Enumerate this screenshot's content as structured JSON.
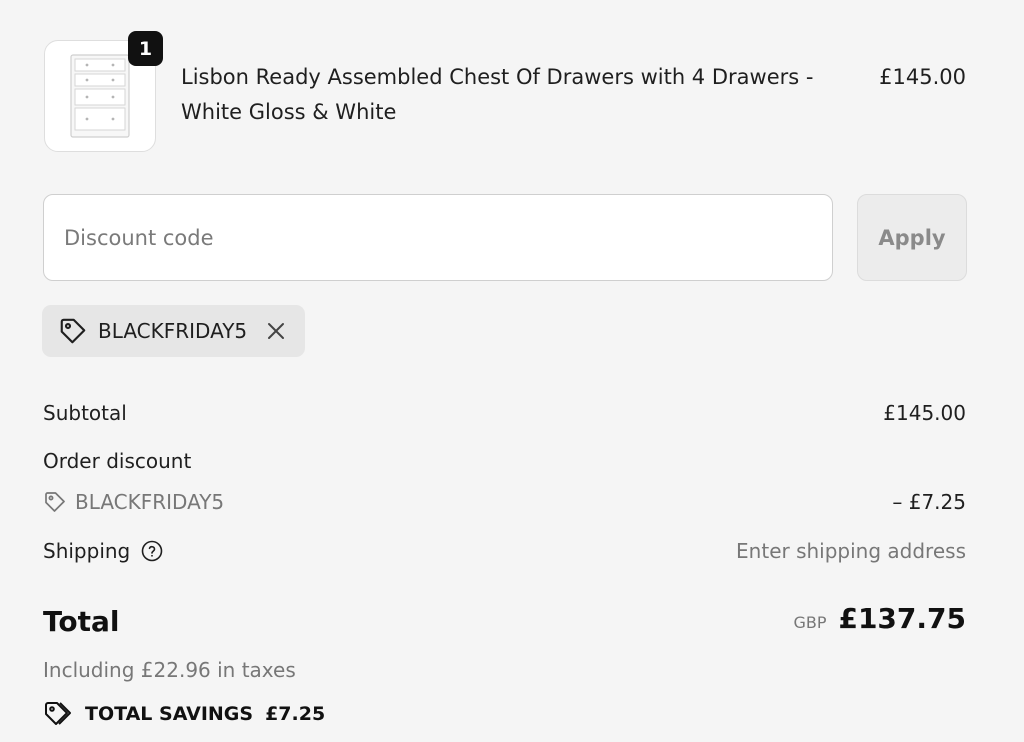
{
  "line_item": {
    "quantity": "1",
    "name": "Lisbon Ready Assembled Chest Of Drawers with 4 Drawers - White Gloss & White",
    "price": "£145.00"
  },
  "discount": {
    "placeholder": "Discount code",
    "apply_label": "Apply",
    "applied_code": "BLACKFRIDAY5"
  },
  "summary": {
    "subtotal_label": "Subtotal",
    "subtotal_value": "£145.00",
    "order_discount_label": "Order discount",
    "order_discount_code": "BLACKFRIDAY5",
    "order_discount_value": "– £7.25",
    "shipping_label": "Shipping",
    "shipping_value": "Enter shipping address",
    "total_label": "Total",
    "currency": "GBP",
    "total_value": "£137.75",
    "tax_note": "Including £22.96 in taxes",
    "savings_label": "TOTAL SAVINGS",
    "savings_value": "£7.25"
  },
  "icons": {
    "tag": "tag-icon",
    "close": "close-icon",
    "help": "question-circle-icon",
    "savings": "tags-icon"
  }
}
